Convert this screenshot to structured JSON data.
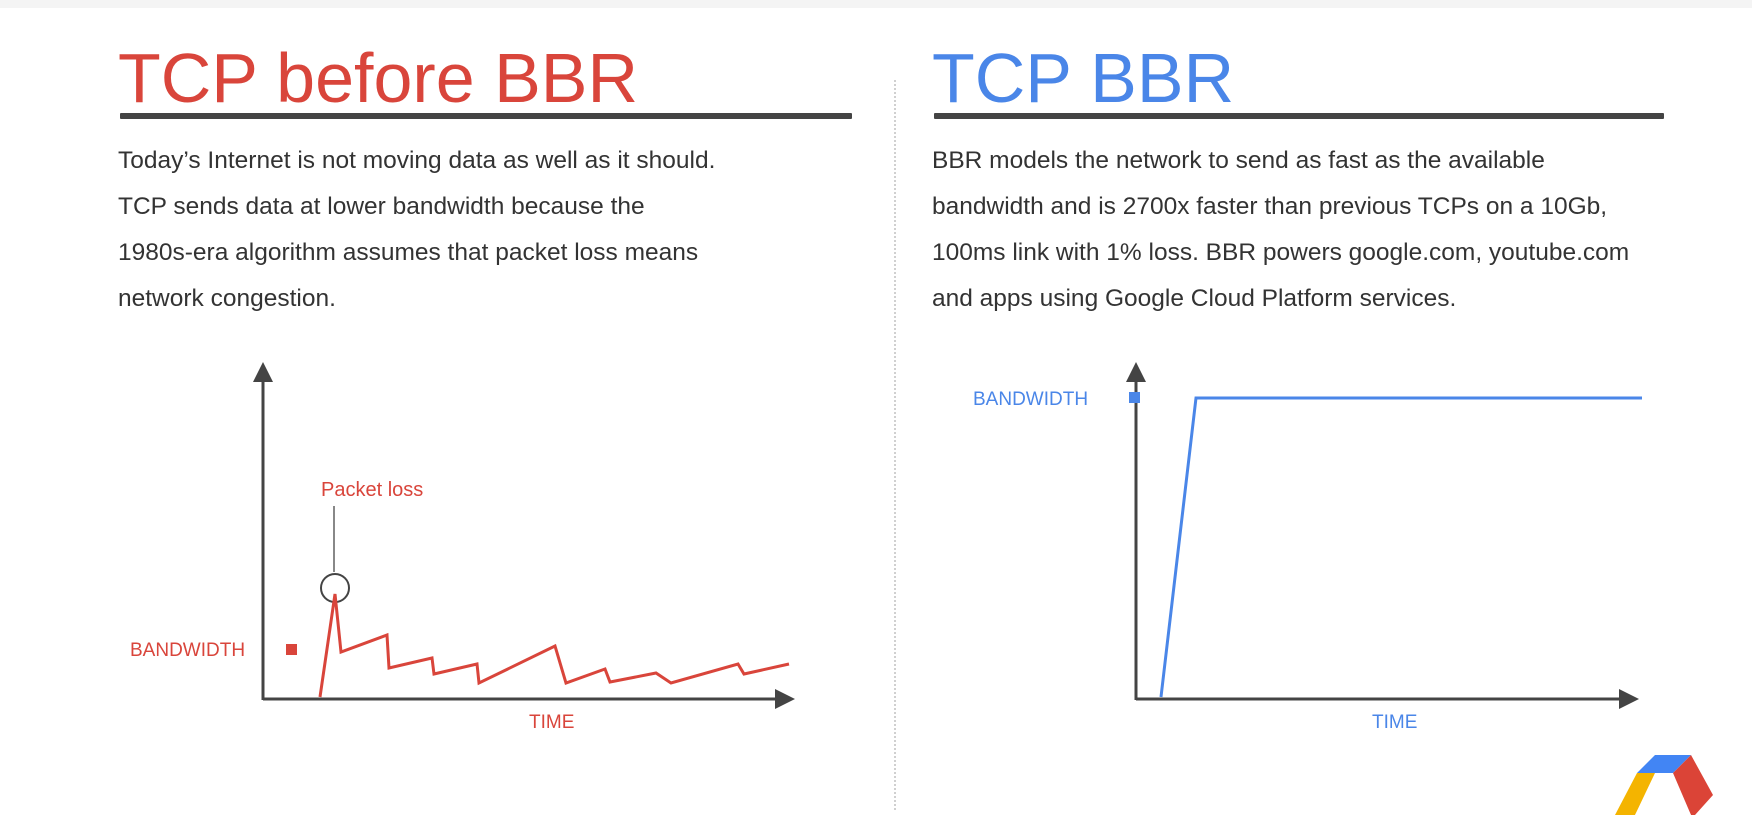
{
  "left": {
    "title": "TCP before BBR",
    "description_lines": [
      "Today’s Internet is not moving data as well as it should.",
      "TCP sends data at lower bandwidth because the",
      "1980s-era algorithm assumes that packet loss means",
      "network congestion."
    ],
    "chart": {
      "y_label": "BANDWIDTH",
      "x_label": "TIME",
      "annotation": "Packet loss",
      "color": "#d9453b"
    }
  },
  "right": {
    "title": "TCP BBR",
    "description_lines": [
      "BBR models the network to send as fast as the available",
      "bandwidth and is 2700x faster than previous TCPs on a 10Gb,",
      "100ms link with 1% loss. BBR powers google.com, youtube.com",
      "and apps using Google Cloud Platform services."
    ],
    "chart": {
      "y_label": "BANDWIDTH",
      "x_label": "TIME",
      "color": "#4a86e8"
    }
  },
  "colors": {
    "accent_red": "#d9453b",
    "accent_blue": "#4a86e8",
    "axis": "#444444",
    "text": "#333333"
  },
  "logo_icon": "google-cloud-platform-logo-icon"
}
